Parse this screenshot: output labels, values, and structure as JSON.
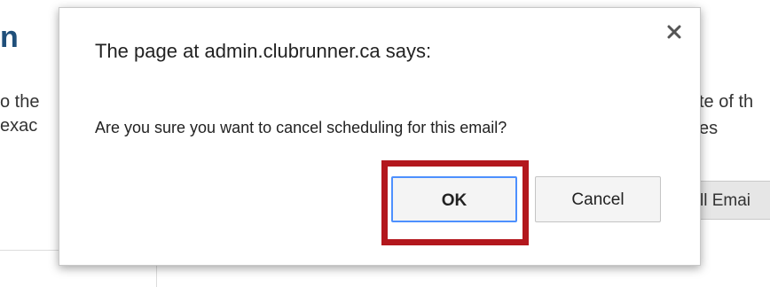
{
  "background": {
    "heading_fragment": "n",
    "text_left_line1": "o the",
    "text_left_line2": "exac",
    "text_right_line1": "te of th",
    "text_right_line2": "es",
    "button_fragment": "ll Emai"
  },
  "dialog": {
    "title": "The page at admin.clubrunner.ca says:",
    "message": "Are you sure you want to cancel scheduling for this email?",
    "ok_label": "OK",
    "cancel_label": "Cancel",
    "close_icon": "close-icon"
  },
  "colors": {
    "highlight": "#b3171d",
    "ok_focus_border": "#4d90fe",
    "heading": "#1f4f7a"
  }
}
